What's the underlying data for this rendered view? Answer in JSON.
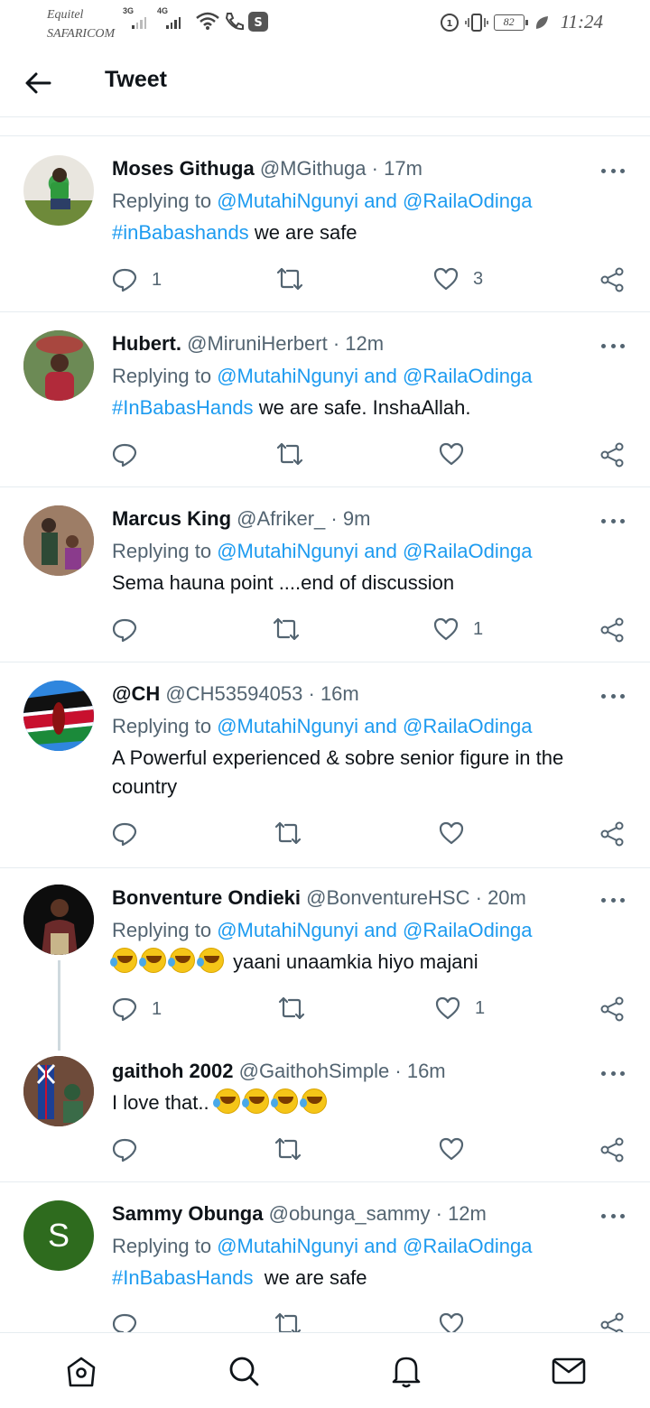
{
  "status_bar": {
    "carrier_line1": "Equitel",
    "carrier_line2": "SAFARICOM",
    "net1": "3G",
    "net2": "4G",
    "battery": "82",
    "time": "11:24"
  },
  "header": {
    "title": "Tweet"
  },
  "tweets": [
    {
      "name": "Moses Githuga",
      "handle": "@MGithuga",
      "time": "17m",
      "replying_prefix": "Replying to",
      "reply_to_1": "@MutahiNgunyi",
      "reply_and": "and",
      "reply_to_2": "@RailaOdinga",
      "hashtag": "#inBabashands",
      "text": "we are safe",
      "replies": "1",
      "retweets": "",
      "likes": "3"
    },
    {
      "name": "Hubert.",
      "handle": "@MiruniHerbert",
      "time": "12m",
      "replying_prefix": "Replying to",
      "reply_to_1": "@MutahiNgunyi",
      "reply_and": "and",
      "reply_to_2": "@RailaOdinga",
      "hashtag": "#InBabasHands",
      "text": "we are safe. InshaAllah.",
      "replies": "",
      "retweets": "",
      "likes": ""
    },
    {
      "name": "Marcus King",
      "handle": "@Afriker_",
      "time": "9m",
      "replying_prefix": "Replying to",
      "reply_to_1": "@MutahiNgunyi",
      "reply_and": "and",
      "reply_to_2": "@RailaOdinga",
      "text": "Sema hauna point ....end of discussion",
      "replies": "",
      "retweets": "",
      "likes": "1"
    },
    {
      "name": "@CH",
      "handle": "@CH53594053",
      "time": "16m",
      "replying_prefix": "Replying to",
      "reply_to_1": "@MutahiNgunyi",
      "reply_and": "and",
      "reply_to_2": "@RailaOdinga",
      "text": "A Powerful experienced & sobre senior figure in the country",
      "replies": "",
      "retweets": "",
      "likes": ""
    },
    {
      "name": "Bonventure Ondieki",
      "handle": "@BonventureHSC",
      "time": "20m",
      "replying_prefix": "Replying to",
      "reply_to_1": "@MutahiNgunyi",
      "reply_and": "and",
      "reply_to_2": "@RailaOdinga",
      "text": "yaani unaamkia hiyo majani",
      "replies": "1",
      "retweets": "",
      "likes": "1"
    },
    {
      "name": "gaithoh 2002",
      "handle": "@GaithohSimple",
      "time": "16m",
      "text": "I love that..",
      "replies": "",
      "retweets": "",
      "likes": ""
    },
    {
      "name": "Sammy Obunga",
      "handle": "@obunga_sammy",
      "time": "12m",
      "avatar_letter": "S",
      "replying_prefix": "Replying to",
      "reply_to_1": "@MutahiNgunyi",
      "reply_and": "and",
      "reply_to_2": "@RailaOdinga",
      "hashtag": "#InBabasHands",
      "text": "we are safe"
    }
  ],
  "icons": {
    "back": "arrow-left-icon",
    "reply": "speech-bubble-icon",
    "retweet": "retweet-icon",
    "like": "heart-icon",
    "share": "share-icon",
    "more": "more-icon",
    "home": "home-icon",
    "search": "search-icon",
    "notifications": "bell-icon",
    "messages": "mail-icon"
  },
  "colors": {
    "link": "#1d9bf0",
    "secondary_text": "#536471",
    "primary_text": "#0f1419",
    "divider": "#e6ecf0",
    "avatar_s_bg": "#2e6b1e"
  }
}
